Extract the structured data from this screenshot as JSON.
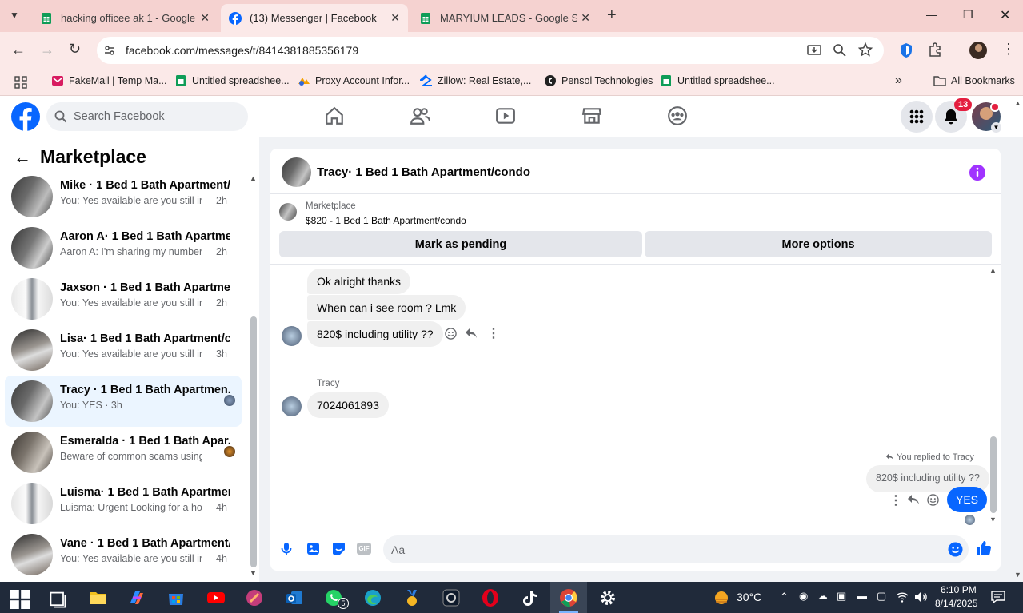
{
  "browser": {
    "tabs": [
      {
        "title": "hacking officee ak 1 - Google Sl",
        "active": false
      },
      {
        "title": "(13) Messenger | Facebook",
        "active": true
      },
      {
        "title": "MARYIUM LEADS - Google She",
        "active": false
      }
    ],
    "url": "facebook.com/messages/t/8414381885356179",
    "bookmarks": [
      "FakeMail | Temp Ma...",
      "Untitled spreadshee...",
      "Proxy Account Infor...",
      "Zillow: Real Estate,...",
      "Pensol Technologies",
      "Untitled spreadshee..."
    ],
    "all_bookmarks": "All Bookmarks"
  },
  "fb": {
    "search_placeholder": "Search Facebook",
    "notification_count": "13"
  },
  "marketplace": {
    "title": "Marketplace",
    "conversations": [
      {
        "name": "Mike · 1 Bed 1 Bath Apartment/c...",
        "preview": "You: Yes available are you still inter...",
        "time": "2h"
      },
      {
        "name": "Aaron A· 1 Bed 1 Bath Apartmen...",
        "preview": "Aaron A: I'm sharing my number wi...",
        "time": "2h"
      },
      {
        "name": "Jaxson · 1 Bed 1 Bath Apartment...",
        "preview": "You: Yes available are you still inter...",
        "time": "2h"
      },
      {
        "name": "Lisa· 1 Bed 1 Bath Apartment/co...",
        "preview": "You: Yes available are you still inter...",
        "time": "3h"
      },
      {
        "name": "Tracy · 1 Bed 1 Bath Apartmen...",
        "preview": "You: YES · 3h",
        "time": ""
      },
      {
        "name": "Esmeralda · 1 Bed 1 Bath Apar...",
        "preview": "Beware of common scams using... · 3h",
        "time": ""
      },
      {
        "name": "Luisma· 1 Bed 1 Bath Apartment...",
        "preview": "Luisma: Urgent Looking for a hous...",
        "time": "4h"
      },
      {
        "name": "Vane · 1 Bed 1 Bath Apartment/c...",
        "preview": "You: Yes available are you still inter...",
        "time": "4h"
      }
    ]
  },
  "chat": {
    "title": "Tracy· 1 Bed 1 Bath Apartment/condo",
    "listing_label": "Marketplace",
    "listing_detail": "$820 - 1 Bed 1 Bath Apartment/condo",
    "mark_pending": "Mark as pending",
    "more_options": "More options",
    "messages": {
      "m1": "Ok alright thanks",
      "m2": "When can i see room ? Lmk",
      "m3": "820$ including utility ??",
      "sender": "Tracy",
      "m4": "7024061893",
      "replied_to": "You replied to Tracy",
      "quoted": "820$ including utility ??",
      "mine": "YES"
    },
    "composer_placeholder": "Aa"
  },
  "taskbar": {
    "weather": "30°C",
    "whatsapp_badge": "5",
    "time": "6:10 PM",
    "date": "8/14/2025"
  },
  "colors": {
    "fb_blue": "#0866ff",
    "titlebar": "#f5d2d0",
    "notify_red": "#e41e3f",
    "info_purple": "#a033ff"
  }
}
